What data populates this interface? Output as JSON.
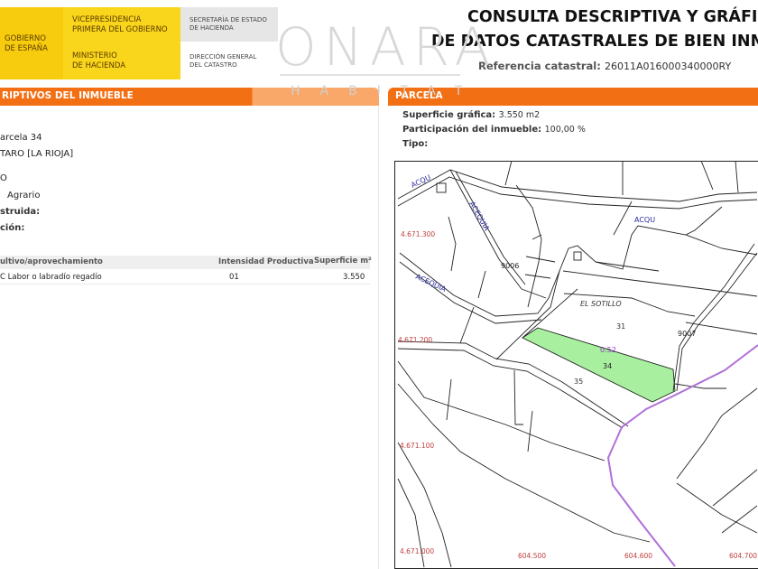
{
  "logo": {
    "gob1": "GOBIERNO",
    "gob2": "DE ESPAÑA",
    "vice1": "VICEPRESIDENCIA",
    "vice2": "PRIMERA DEL GOBIERNO",
    "min1": "MINISTERIO",
    "min2": "DE HACIENDA",
    "sec1": "SECRETARÍA DE ESTADO",
    "sec2": "DE HACIENDA",
    "dir1": "DIRECCIÓN GENERAL",
    "dir2": "DEL CATASTRO"
  },
  "watermark": {
    "top": "ONARA",
    "bottom": "HABITAT"
  },
  "header": {
    "title1": "CONSULTA DESCRIPTIVA Y GRÁFICA",
    "title2": "DE DATOS CATASTRALES DE BIEN INMU",
    "ref_label": "Referencia catastral:",
    "ref_value": "26011A016000340000RY"
  },
  "left": {
    "section": "RIPTIVOS DEL INMUEBLE",
    "lines": [
      "arcela 34",
      "TARO [LA RIOJA]",
      "O",
      "Agrario",
      "struida:",
      "ción:"
    ],
    "table": {
      "headers": [
        "ultivo/aprovechamiento",
        "Intensidad Productiva",
        "Superficie m²"
      ],
      "rows": [
        [
          "C Labor o labradío regadío",
          "01",
          "3.550"
        ]
      ]
    }
  },
  "parcela": {
    "section": "PARCELA",
    "sup_label": "Superficie gráfica:",
    "sup_value": "3.550 m2",
    "part_label": "Participación del inmueble:",
    "part_value": "100,00 %",
    "tipo_label": "Tipo:"
  },
  "map": {
    "labels": {
      "acqu1": "ACQU",
      "acequia1": "ACEQUIA",
      "n9006": "9006",
      "acequia2": "ACEQUIA",
      "acqu2": "ACQU",
      "sotillo": "EL SOTILLO",
      "n31": "31",
      "n9007": "9007",
      "sub": "0.52",
      "n34": "34",
      "n35": "35"
    },
    "y_ticks": [
      "4.671.300",
      "4.671.200",
      "4.671.100",
      "4.671.000"
    ],
    "x_ticks": [
      "604.500",
      "604.600",
      "604.700"
    ],
    "colors": {
      "parcel": "#a8f0a0",
      "boundary": "#b070d8",
      "coords": "#c04040",
      "water": "#2a2aa0"
    }
  }
}
